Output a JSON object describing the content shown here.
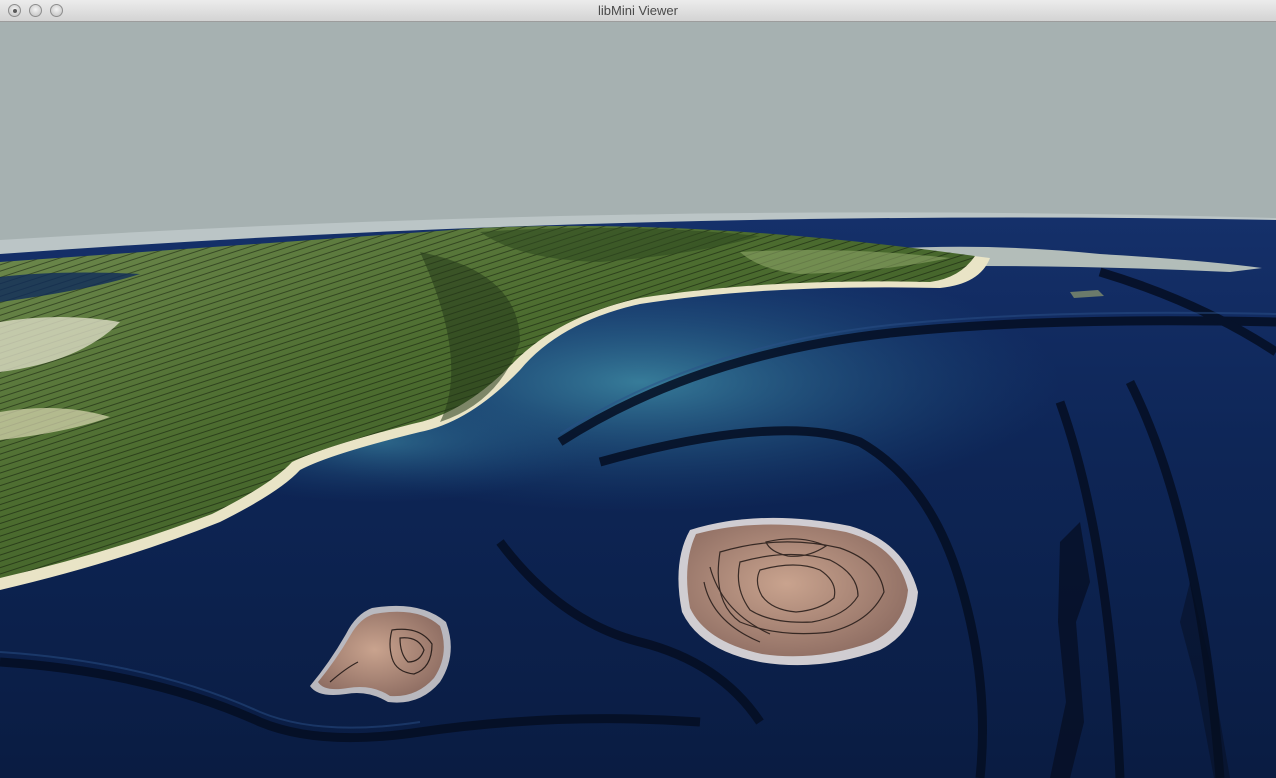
{
  "window": {
    "title": "libMini Viewer",
    "controls": [
      "close",
      "minimize",
      "zoom"
    ]
  },
  "scene": {
    "sky_color": "#a6b1b1",
    "ocean_color": "#0d2452",
    "shallow_color": "#2f6f8f",
    "land_color": "#3f6a2a",
    "island_color": "#b08a78",
    "contour_color": "#000000"
  }
}
